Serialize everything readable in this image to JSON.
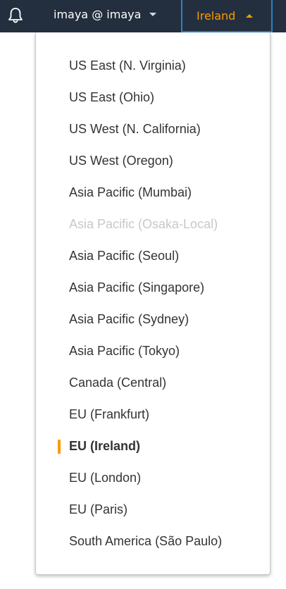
{
  "nav": {
    "bell_icon": "bell-icon",
    "account_label": "imaya @ imaya",
    "region_label": "Ireland",
    "accent_color": "#ff9900",
    "bar_color": "#232f3e"
  },
  "regions": [
    {
      "label": "US East (N. Virginia)"
    },
    {
      "label": "US East (Ohio)"
    },
    {
      "label": "US West (N. California)"
    },
    {
      "label": "US West (Oregon)"
    },
    {
      "label": "Asia Pacific (Mumbai)"
    },
    {
      "label": "Asia Pacific (Osaka-Local)",
      "disabled": true
    },
    {
      "label": "Asia Pacific (Seoul)"
    },
    {
      "label": "Asia Pacific (Singapore)"
    },
    {
      "label": "Asia Pacific (Sydney)"
    },
    {
      "label": "Asia Pacific (Tokyo)"
    },
    {
      "label": "Canada (Central)"
    },
    {
      "label": "EU (Frankfurt)"
    },
    {
      "label": "EU (Ireland)",
      "selected": true
    },
    {
      "label": "EU (London)"
    },
    {
      "label": "EU (Paris)"
    },
    {
      "label": "South America (São Paulo)"
    }
  ]
}
